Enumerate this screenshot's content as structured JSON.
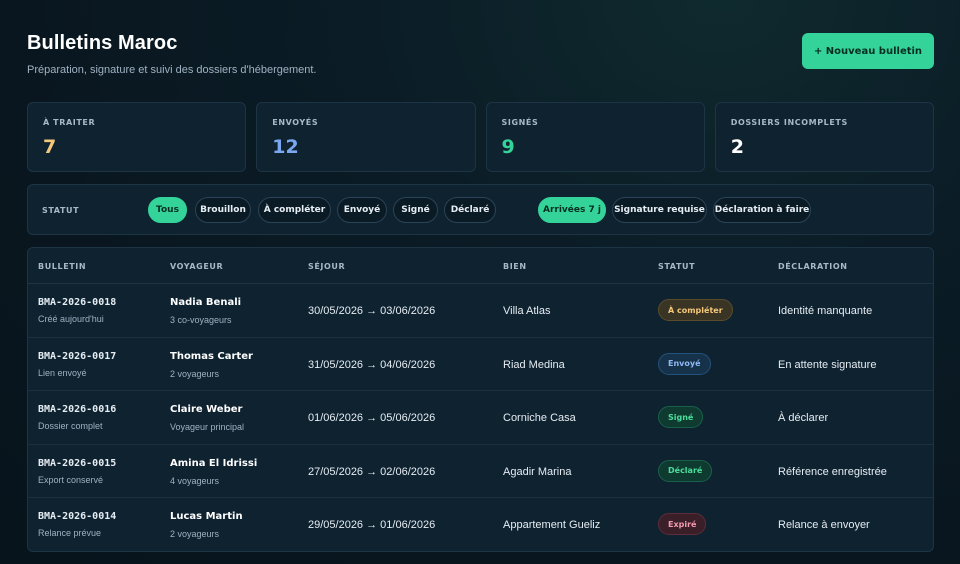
{
  "header": {
    "title": "Bulletins Maroc",
    "subtitle": "Préparation, signature et suivi des dossiers d'hébergement.",
    "new_button": "+ Nouveau bulletin"
  },
  "kpis": [
    {
      "label": "À TRAITER",
      "value": "7",
      "color": "#f4c77a"
    },
    {
      "label": "ENVOYÉS",
      "value": "12",
      "color": "#7aa7f0"
    },
    {
      "label": "SIGNÉS",
      "value": "9",
      "color": "#34d399"
    },
    {
      "label": "DOSSIERS INCOMPLETS",
      "value": "2",
      "color": "#ffffff"
    }
  ],
  "filters": {
    "label": "STATUT",
    "status": [
      "Tous",
      "Brouillon",
      "À compléter",
      "Envoyé",
      "Signé",
      "Déclaré"
    ],
    "quick": [
      "Arrivées 7 j",
      "Signature requise",
      "Déclaration à faire"
    ]
  },
  "table": {
    "headers": [
      "BULLETIN",
      "VOYAGEUR",
      "SÉJOUR",
      "BIEN",
      "STATUT",
      "DÉCLARATION"
    ],
    "rows": [
      {
        "code": "BMA-2026-0018",
        "code_sub": "Créé aujourd'hui",
        "name": "Nadia Benali",
        "name_sub": "3 co-voyageurs",
        "stay": "30/05/2026 → 03/06/2026",
        "bien": "Villa Atlas",
        "status": "À compléter",
        "declaration": "Identité manquante"
      },
      {
        "code": "BMA-2026-0017",
        "code_sub": "Lien envoyé",
        "name": "Thomas Carter",
        "name_sub": "2 voyageurs",
        "stay": "31/05/2026 → 04/06/2026",
        "bien": "Riad Medina",
        "status": "Envoyé",
        "declaration": "En attente signature"
      },
      {
        "code": "BMA-2026-0016",
        "code_sub": "Dossier complet",
        "name": "Claire Weber",
        "name_sub": "Voyageur principal",
        "stay": "01/06/2026 → 05/06/2026",
        "bien": "Corniche Casa",
        "status": "Signé",
        "declaration": "À déclarer"
      },
      {
        "code": "BMA-2026-0015",
        "code_sub": "Export conservé",
        "name": "Amina El Idrissi",
        "name_sub": "4 voyageurs",
        "stay": "27/05/2026 → 02/06/2026",
        "bien": "Agadir Marina",
        "status": "Déclaré",
        "declaration": "Référence enregistrée"
      },
      {
        "code": "BMA-2026-0014",
        "code_sub": "Relance prévue",
        "name": "Lucas Martin",
        "name_sub": "2 voyageurs",
        "stay": "29/05/2026 → 01/06/2026",
        "bien": "Appartement Gueliz",
        "status": "Expiré",
        "declaration": "Relance à envoyer"
      }
    ]
  },
  "status_colors": {
    "À compléter": {
      "bg": "#3a3424",
      "border": "#5a4d2c",
      "text": "#f4c77a"
    },
    "Envoyé": {
      "bg": "#15324a",
      "border": "#24527a",
      "text": "#8fb8f5"
    },
    "Signé": {
      "bg": "#0f3a30",
      "border": "#19604a",
      "text": "#4ade9c"
    },
    "Déclaré": {
      "bg": "#0f3a30",
      "border": "#19604a",
      "text": "#4ade9c"
    },
    "Expiré": {
      "bg": "#3a1e28",
      "border": "#5e2c3a",
      "text": "#f59ab0"
    }
  }
}
